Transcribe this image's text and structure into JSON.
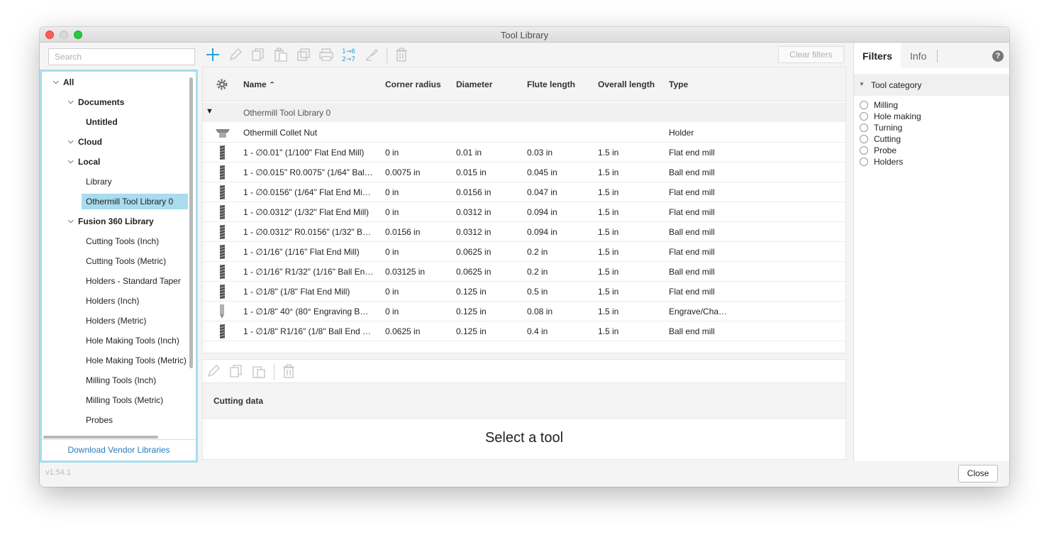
{
  "window": {
    "title": "Tool Library"
  },
  "search": {
    "placeholder": "Search"
  },
  "tree": {
    "all": "All",
    "documents": "Documents",
    "untitled": "Untitled",
    "cloud": "Cloud",
    "local": "Local",
    "library": "Library",
    "othermill": "Othermill Tool Library 0",
    "fusion": "Fusion 360 Library",
    "items": [
      "Cutting Tools (Inch)",
      "Cutting Tools (Metric)",
      "Holders - Standard Taper",
      "Holders (Inch)",
      "Holders (Metric)",
      "Hole Making Tools (Inch)",
      "Hole Making Tools (Metric)",
      "Milling Tools (Inch)",
      "Milling Tools (Metric)",
      "Probes"
    ],
    "vendor_link": "Download Vendor Libraries"
  },
  "toolbar": {
    "clear_filters": "Clear filters"
  },
  "table": {
    "headers": {
      "name": "Name",
      "corner_radius": "Corner radius",
      "diameter": "Diameter",
      "flute_length": "Flute length",
      "overall_length": "Overall length",
      "type": "Type"
    },
    "group": "Othermill Tool Library 0",
    "rows": [
      {
        "name": "Othermill Collet Nut",
        "corner": "",
        "diameter": "",
        "flute": "",
        "overall": "",
        "type": "Holder"
      },
      {
        "name": "1 - ∅0.01\" (1/100\" Flat End Mill)",
        "corner": "0 in",
        "diameter": "0.01 in",
        "flute": "0.03 in",
        "overall": "1.5 in",
        "type": "Flat end mill"
      },
      {
        "name": "1 - ∅0.015\" R0.0075\" (1/64\" Bal…",
        "corner": "0.0075 in",
        "diameter": "0.015 in",
        "flute": "0.045 in",
        "overall": "1.5 in",
        "type": "Ball end mill"
      },
      {
        "name": "1 - ∅0.0156\" (1/64\" Flat End Mi…",
        "corner": "0 in",
        "diameter": "0.0156 in",
        "flute": "0.047 in",
        "overall": "1.5 in",
        "type": "Flat end mill"
      },
      {
        "name": "1 - ∅0.0312\" (1/32\" Flat End Mill)",
        "corner": "0 in",
        "diameter": "0.0312 in",
        "flute": "0.094 in",
        "overall": "1.5 in",
        "type": "Flat end mill"
      },
      {
        "name": "1 - ∅0.0312\" R0.0156\" (1/32\" B…",
        "corner": "0.0156 in",
        "diameter": "0.0312 in",
        "flute": "0.094 in",
        "overall": "1.5 in",
        "type": "Ball end mill"
      },
      {
        "name": "1 - ∅1/16\" (1/16\" Flat End Mill)",
        "corner": "0 in",
        "diameter": "0.0625 in",
        "flute": "0.2 in",
        "overall": "1.5 in",
        "type": "Flat end mill"
      },
      {
        "name": "1 - ∅1/16\" R1/32\" (1/16\" Ball En…",
        "corner": "0.03125 in",
        "diameter": "0.0625 in",
        "flute": "0.2 in",
        "overall": "1.5 in",
        "type": "Ball end mill"
      },
      {
        "name": "1 - ∅1/8\" (1/8\" Flat End Mill)",
        "corner": "0 in",
        "diameter": "0.125 in",
        "flute": "0.5 in",
        "overall": "1.5 in",
        "type": "Flat end mill"
      },
      {
        "name": "1 - ∅1/8\" 40° (80° Engraving B…",
        "corner": "0 in",
        "diameter": "0.125 in",
        "flute": "0.08 in",
        "overall": "1.5 in",
        "type": "Engrave/Cha…"
      },
      {
        "name": "1 - ∅1/8\" R1/16\" (1/8\" Ball End …",
        "corner": "0.0625 in",
        "diameter": "0.125 in",
        "flute": "0.4 in",
        "overall": "1.5 in",
        "type": "Ball end mill"
      }
    ]
  },
  "cutting": {
    "header": "Cutting data",
    "empty": "Select a tool"
  },
  "filters": {
    "tab_filters": "Filters",
    "tab_info": "Info",
    "help": "?",
    "category": "Tool category",
    "options": [
      "Milling",
      "Hole making",
      "Turning",
      "Cutting",
      "Probe",
      "Holders"
    ]
  },
  "footer": {
    "version": "v1.54.1",
    "close": "Close"
  },
  "colors": {
    "accent": "#2a9fd6",
    "selection": "#a8dcee",
    "link": "#2a7ab9"
  }
}
